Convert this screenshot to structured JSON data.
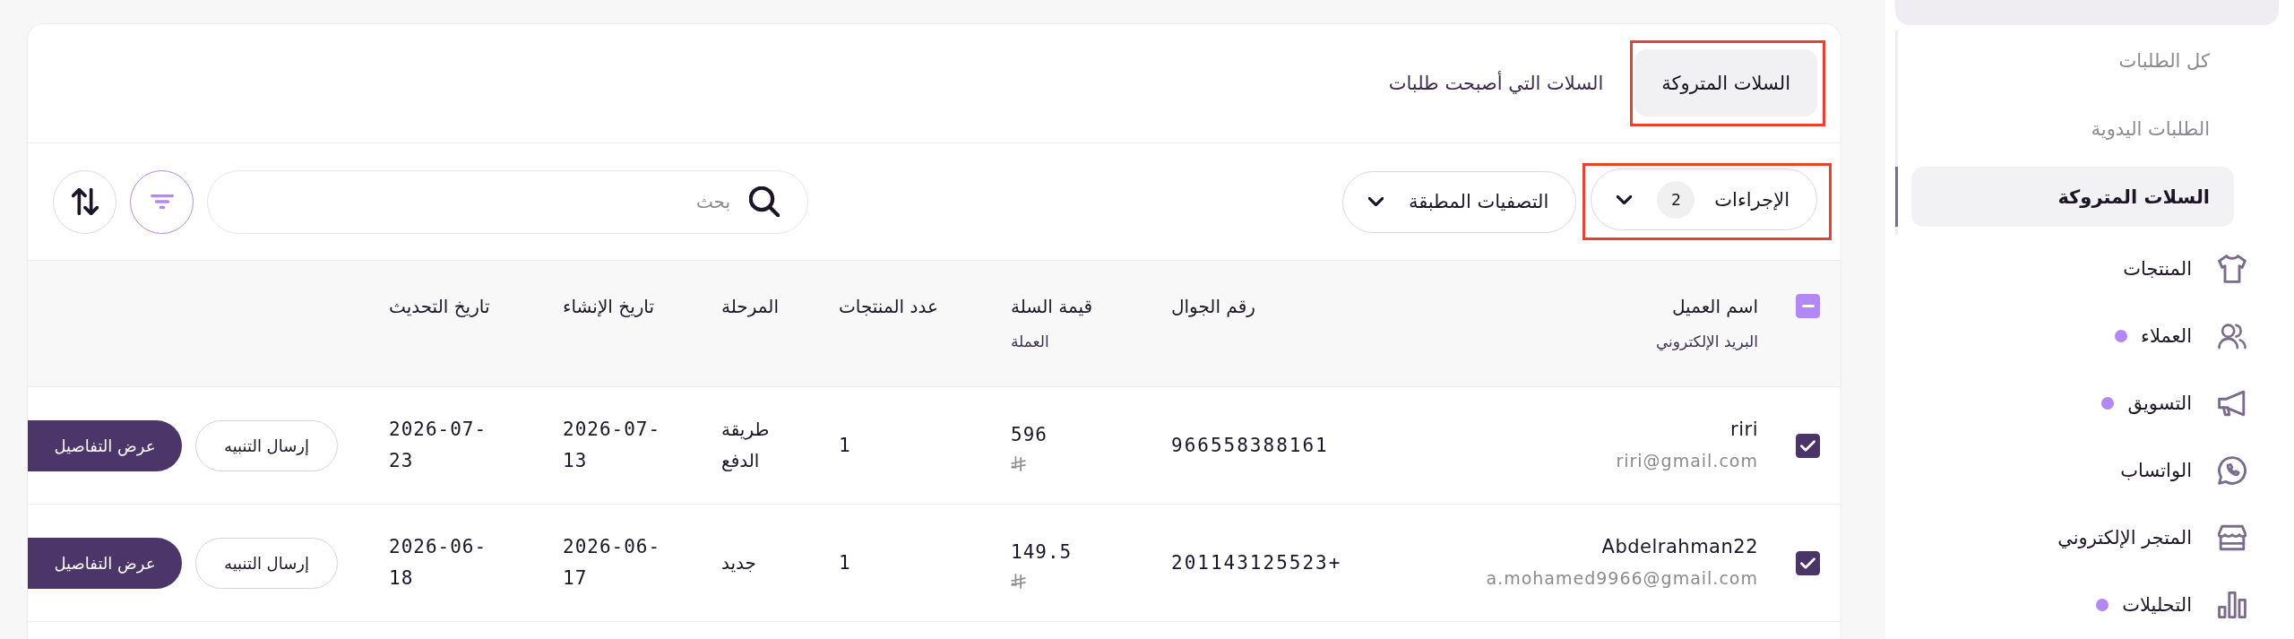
{
  "sidebar": {
    "subitems": [
      {
        "label": "كل الطلبات",
        "selected": false
      },
      {
        "label": "الطلبات اليدوية",
        "selected": false
      },
      {
        "label": "السلات المتروكة",
        "selected": true
      }
    ],
    "items": [
      {
        "label": "المنتجات",
        "notification": false
      },
      {
        "label": "العملاء",
        "notification": true
      },
      {
        "label": "التسويق",
        "notification": true
      },
      {
        "label": "الواتساب",
        "notification": false
      },
      {
        "label": "المتجر الإلكتروني",
        "notification": false
      },
      {
        "label": "التحليلات",
        "notification": true
      }
    ]
  },
  "tabs": [
    {
      "label": "السلات المتروكة",
      "selected": true,
      "highlighted": true
    },
    {
      "label": "السلات التي أصبحت طلبات",
      "selected": false,
      "highlighted": false
    }
  ],
  "toolbar": {
    "actions_button": {
      "label": "الإجراءات",
      "count": "2",
      "highlighted": true
    },
    "filters_button": {
      "label": "التصفيات المطبقة",
      "highlighted": false
    },
    "search": {
      "placeholder": "بحث"
    },
    "filter_toggle": {
      "active": true
    }
  },
  "table": {
    "select_all": {
      "indeterminate": true
    },
    "columns": [
      {
        "label": "اسم العميل",
        "sublabel": "البريد الإلكتروني"
      },
      {
        "label": "رقم الجوال"
      },
      {
        "label": "قيمة السلة",
        "sublabel": "العملة"
      },
      {
        "label": "عدد المنتجات"
      },
      {
        "label": "المرحلة"
      },
      {
        "label": "تاريخ الإنشاء"
      },
      {
        "label": "تاريخ التحديث"
      }
    ],
    "rows": [
      {
        "checked": true,
        "customer_name": "riri",
        "email": "riri@gmail.com",
        "phone": "966558388161",
        "cart_value": "596",
        "product_count": "1",
        "stage": "طريقة الدفع",
        "created": "2026-07-13",
        "updated": "2026-07-23",
        "actions": [
          {
            "label": "إرسال التنبيه",
            "kind": "outline"
          },
          {
            "label": "عرض التفاصيل",
            "kind": "primary"
          }
        ]
      },
      {
        "checked": true,
        "customer_name": "Abdelrahman22",
        "email": "a.mohamed9966@gmail.com",
        "phone": "201143125523+",
        "cart_value": "149.5",
        "product_count": "1",
        "stage": "جديد",
        "created": "2026-06-17",
        "updated": "2026-06-18",
        "actions": [
          {
            "label": "إرسال التنبيه",
            "kind": "outline"
          },
          {
            "label": "عرض التفاصيل",
            "kind": "primary"
          }
        ]
      }
    ]
  }
}
